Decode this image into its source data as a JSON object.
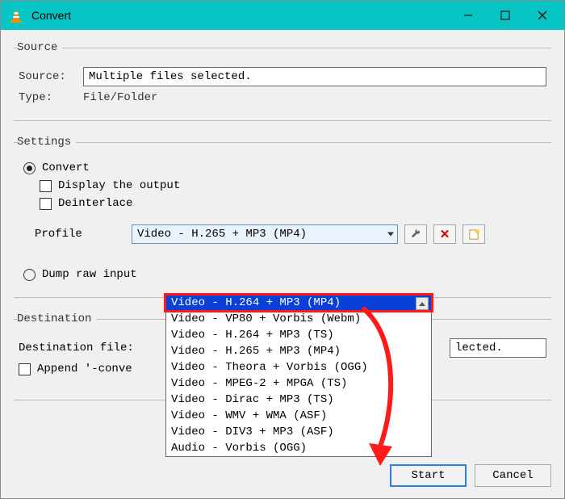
{
  "window": {
    "title": "Convert"
  },
  "source": {
    "legend": "Source",
    "source_label": "Source:",
    "source_value": "Multiple files selected.",
    "type_label": "Type:",
    "type_value": "File/Folder"
  },
  "settings": {
    "legend": "Settings",
    "convert_label": "Convert",
    "display_output_label": "Display the output",
    "deinterlace_label": "Deinterlace",
    "profile_label": "Profile",
    "profile_selected": "Video - H.265 + MP3 (MP4)",
    "dump_raw_label": "Dump raw input",
    "dropdown_items": [
      "Video - H.264 + MP3 (MP4)",
      "Video - VP80 + Vorbis (Webm)",
      "Video - H.264 + MP3 (TS)",
      "Video - H.265 + MP3 (MP4)",
      "Video - Theora + Vorbis (OGG)",
      "Video - MPEG-2 + MPGA (TS)",
      "Video - Dirac + MP3 (TS)",
      "Video - WMV + WMA (ASF)",
      "Video - DIV3 + MP3 (ASF)",
      "Audio - Vorbis (OGG)"
    ]
  },
  "destination": {
    "legend": "Destination",
    "file_label": "Destination file:",
    "file_value_visible": "lected.",
    "append_label": "Append '-conve"
  },
  "buttons": {
    "start": "Start",
    "cancel": "Cancel"
  },
  "icons": {
    "wrench": "wrench-icon",
    "delete": "delete-icon",
    "new": "new-profile-icon"
  }
}
